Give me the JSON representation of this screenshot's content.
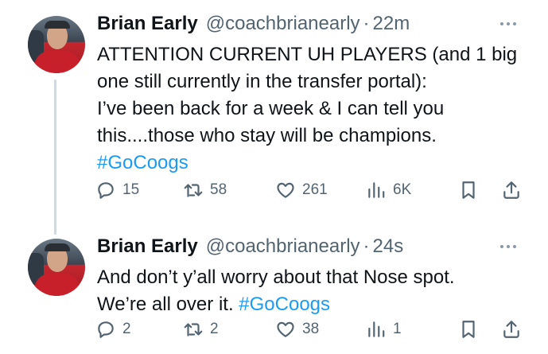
{
  "tweets": [
    {
      "author_name": "Brian Early",
      "handle": "@coachbrianearly",
      "separator": "·",
      "time": "22m",
      "lines": [
        "ATTENTION CURRENT UH PLAYERS (and 1 big",
        "one still currently in the transfer portal):",
        "I’ve been back for a week & I can tell you",
        "this....those who stay will be champions."
      ],
      "hashtag": "#GoCoogs",
      "replies": "15",
      "retweets": "58",
      "likes": "261",
      "views": "6K"
    },
    {
      "author_name": "Brian Early",
      "handle": "@coachbrianearly",
      "separator": "·",
      "time": "24s",
      "lines": [
        "And don’t y’all worry about that Nose spot.",
        "We’re all over it."
      ],
      "hashtag": "#GoCoogs",
      "replies": "2",
      "retweets": "2",
      "likes": "38",
      "views": "1"
    }
  ],
  "icons": {
    "reply": "reply-icon",
    "retweet": "retweet-icon",
    "like": "heart-icon",
    "views": "views-icon",
    "bookmark": "bookmark-icon",
    "share": "share-icon",
    "more": "more-icon"
  },
  "colors": {
    "hashtag": "#1d9bf0",
    "secondary_text": "#536471",
    "thread_line": "#cfd9de"
  }
}
